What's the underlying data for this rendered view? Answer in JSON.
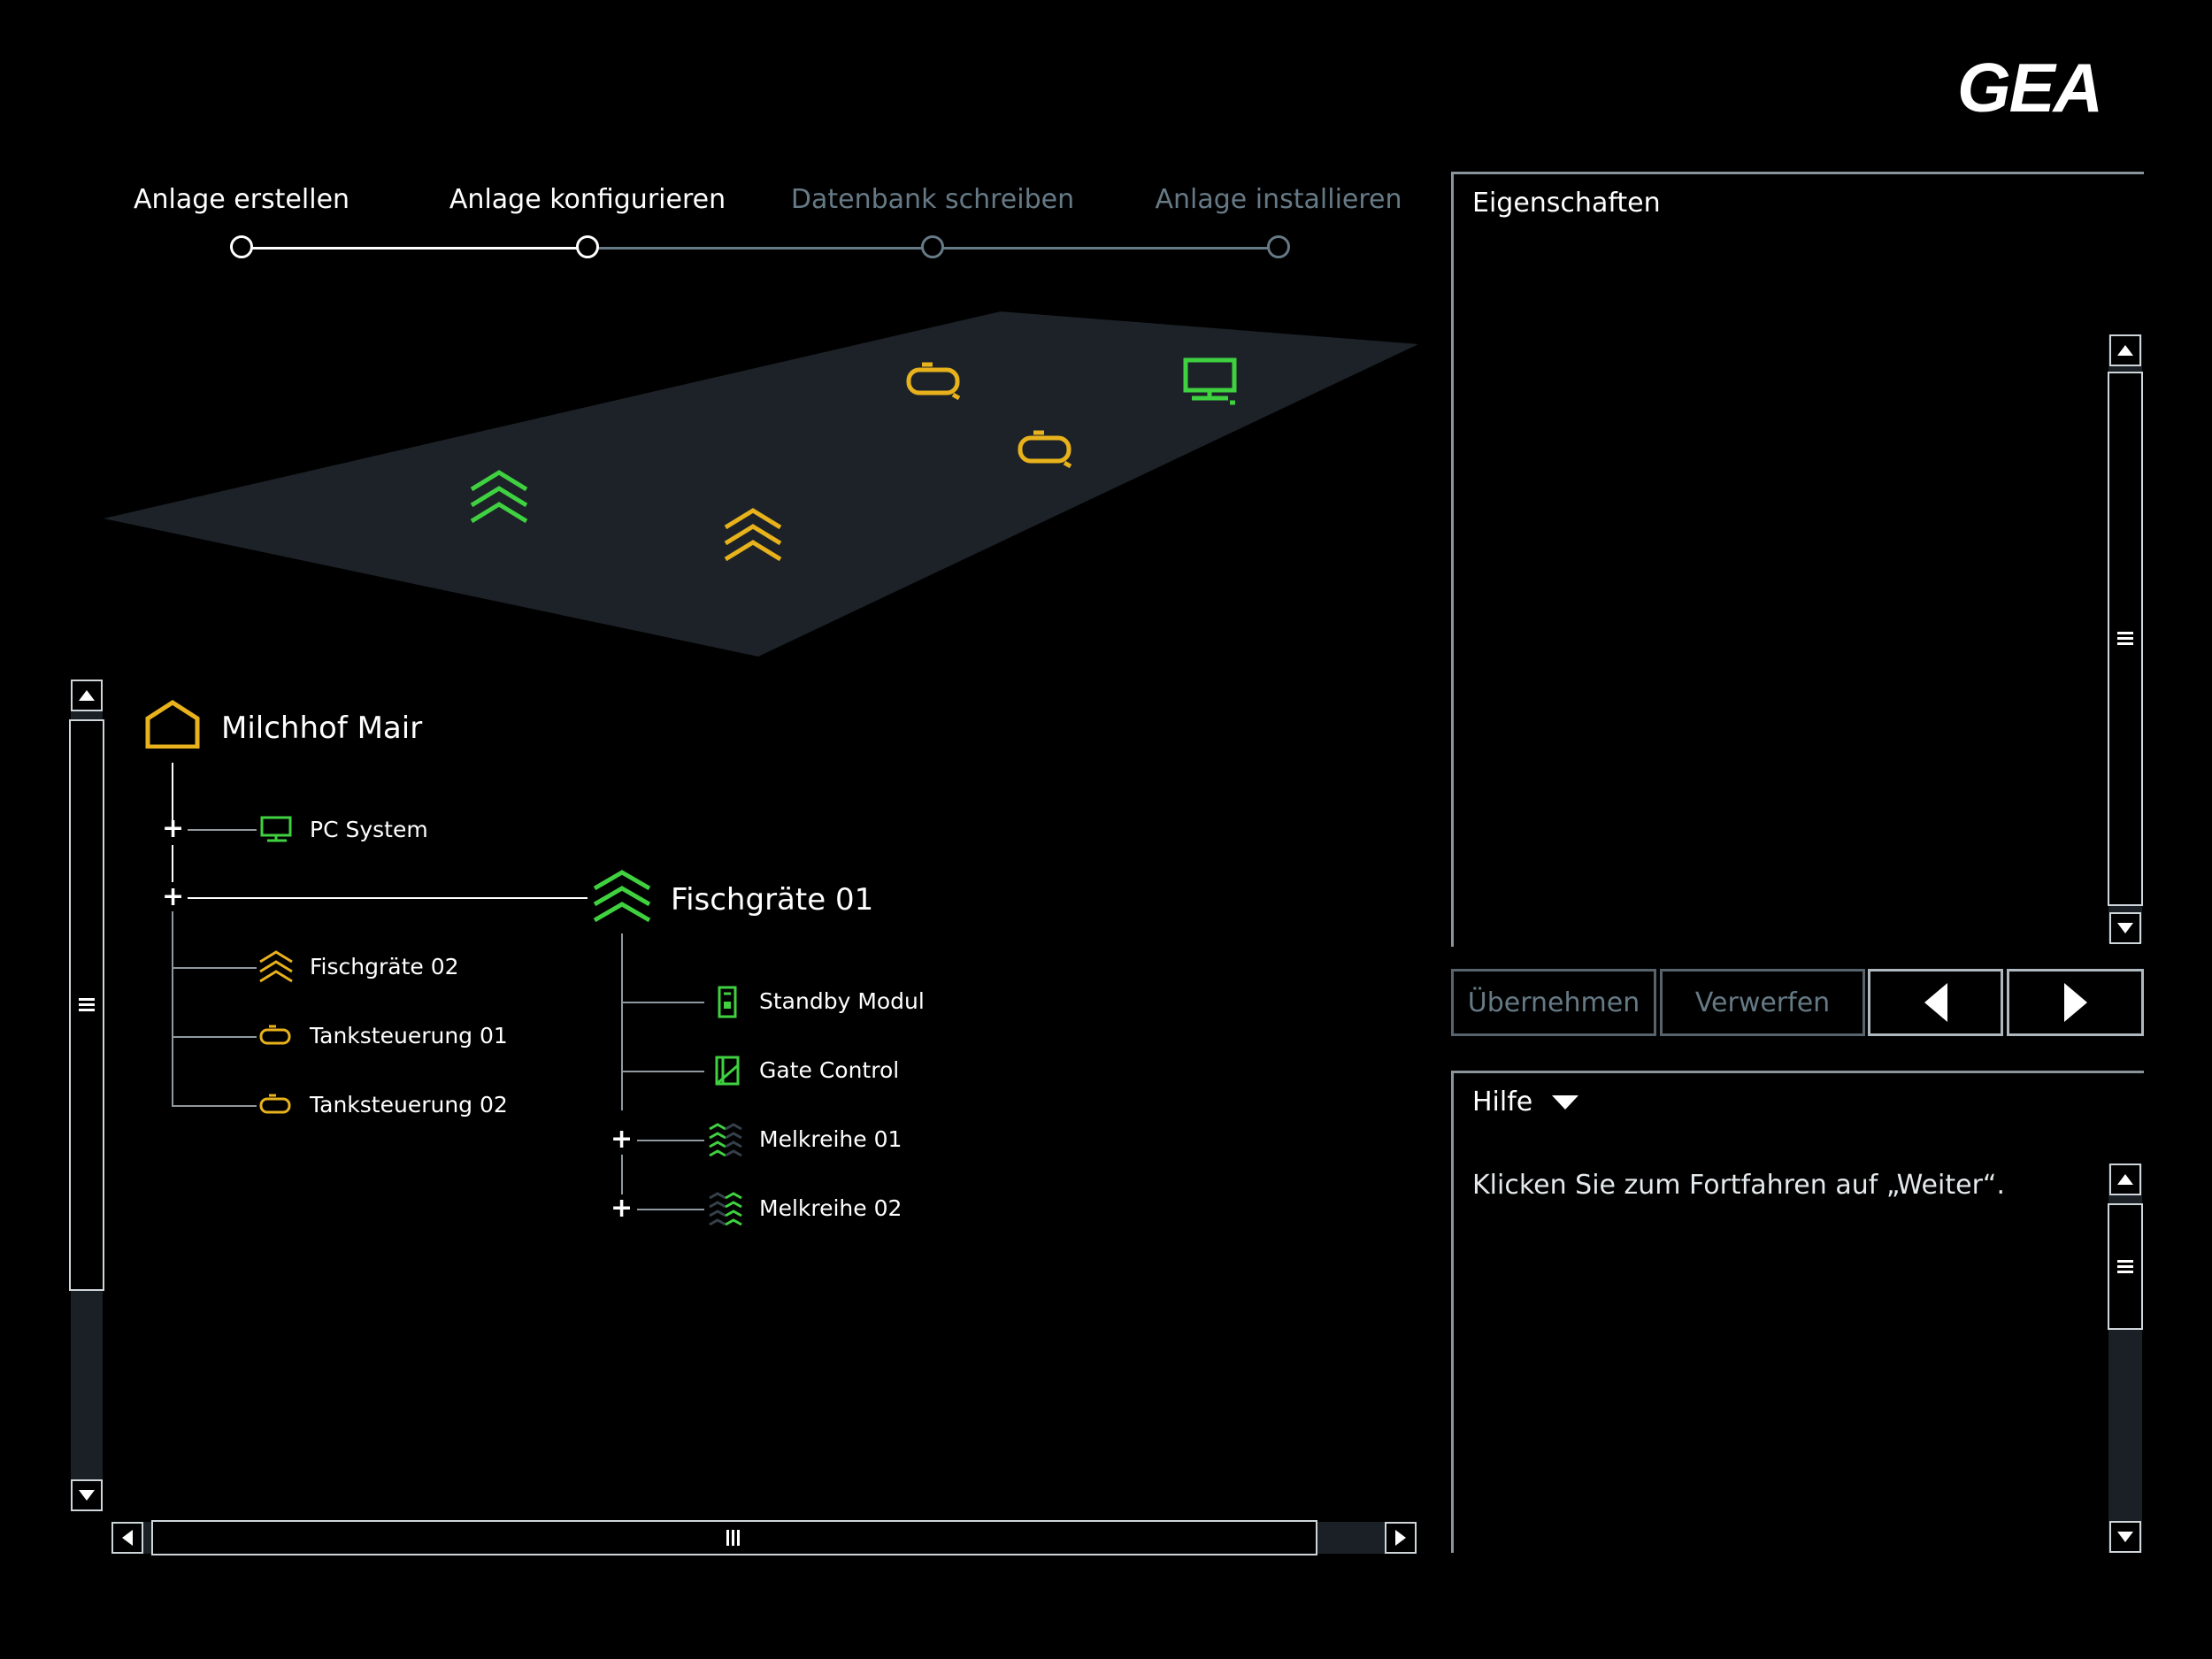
{
  "logo": {
    "text": "GEA"
  },
  "stepper": {
    "steps": [
      {
        "label": "Anlage erstellen",
        "state": "done"
      },
      {
        "label": "Anlage konfigurieren",
        "state": "current"
      },
      {
        "label": "Datenbank schreiben",
        "state": "pending"
      },
      {
        "label": "Anlage installieren",
        "state": "pending"
      }
    ]
  },
  "tree": {
    "root": {
      "label": "Milchhof Mair",
      "icon": "farm-house-icon"
    },
    "items": [
      {
        "label": "PC System",
        "icon": "pc-monitor-icon"
      },
      {
        "label": "Fischgräte 01",
        "icon": "herringbone-parlor-icon",
        "expanded": true
      },
      {
        "label": "Fischgräte 02",
        "icon": "herringbone-parlor-icon"
      },
      {
        "label": "Tanksteuerung 01",
        "icon": "tank-icon"
      },
      {
        "label": "Tanksteuerung 02",
        "icon": "tank-icon"
      }
    ],
    "children": [
      {
        "label": "Standby Modul",
        "icon": "standby-module-icon"
      },
      {
        "label": "Gate Control",
        "icon": "gate-control-icon"
      },
      {
        "label": "Melkreihe 01",
        "icon": "milking-row-icon"
      },
      {
        "label": "Melkreihe 02",
        "icon": "milking-row-icon"
      }
    ]
  },
  "properties": {
    "title": "Eigenschaften"
  },
  "actions": {
    "apply_label": "Übernehmen",
    "discard_label": "Verwerfen",
    "back_icon": "arrow-left-icon",
    "next_icon": "arrow-right-icon"
  },
  "help": {
    "title": "Hilfe",
    "text": "Klicken Sie zum Fortfahren auf „Weiter“."
  },
  "colors": {
    "background": "#000000",
    "accent_green": "#3fd13f",
    "accent_yellow": "#e8b21c",
    "inactive": "#667a86",
    "floor": "#1c2228"
  }
}
